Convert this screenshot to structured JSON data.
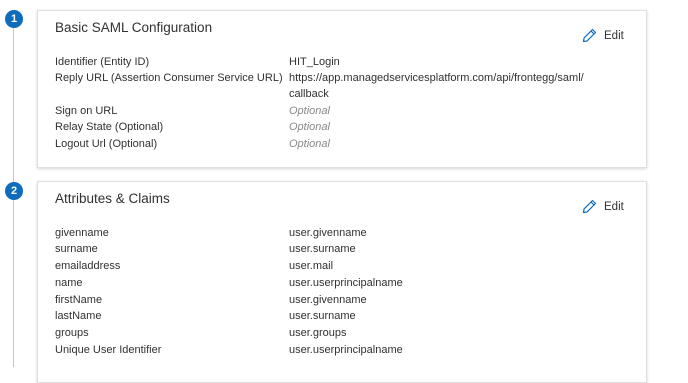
{
  "steps": [
    {
      "number": "1",
      "title": "Basic SAML Configuration",
      "edit_label": "Edit",
      "rows": [
        {
          "label": "Identifier (Entity ID)",
          "value": "HIT_Login",
          "optional": false
        },
        {
          "label": "Reply URL (Assertion Consumer Service URL)",
          "value": "https://app.managedservicesplatform.com/api/frontegg/saml/callback",
          "optional": false
        },
        {
          "label": "Sign on URL",
          "value": "Optional",
          "optional": true
        },
        {
          "label": "Relay State (Optional)",
          "value": "Optional",
          "optional": true
        },
        {
          "label": "Logout Url (Optional)",
          "value": "Optional",
          "optional": true
        }
      ]
    },
    {
      "number": "2",
      "title": "Attributes & Claims",
      "edit_label": "Edit",
      "rows": [
        {
          "label": "givenname",
          "value": "user.givenname",
          "optional": false
        },
        {
          "label": "surname",
          "value": "user.surname",
          "optional": false
        },
        {
          "label": "emailaddress",
          "value": "user.mail",
          "optional": false
        },
        {
          "label": "name",
          "value": "user.userprincipalname",
          "optional": false
        },
        {
          "label": "firstName",
          "value": "user.givenname",
          "optional": false
        },
        {
          "label": "lastName",
          "value": "user.surname",
          "optional": false
        },
        {
          "label": "groups",
          "value": "user.groups",
          "optional": false
        },
        {
          "label": "Unique User Identifier",
          "value": "user.userprincipalname",
          "optional": false
        }
      ]
    }
  ],
  "icons": {
    "edit": "pencil-icon"
  },
  "colors": {
    "step_badge": "#0f6cbd",
    "edit_icon": "#0f6cbd",
    "optional_text": "#8a8886",
    "text": "#323130"
  }
}
